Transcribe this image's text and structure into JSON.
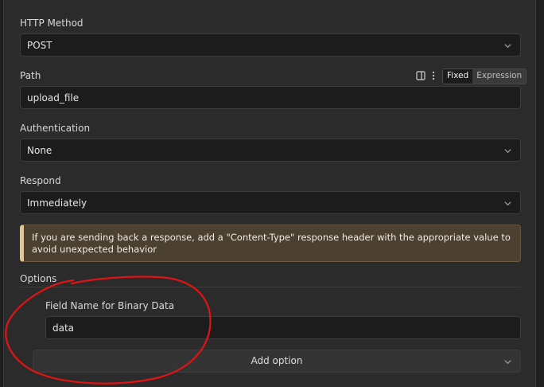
{
  "http_method": {
    "label": "HTTP Method",
    "value": "POST"
  },
  "path": {
    "label": "Path",
    "value": "upload_file",
    "mode_toggle": {
      "fixed_label": "Fixed",
      "expression_label": "Expression",
      "selected": "Fixed"
    }
  },
  "authentication": {
    "label": "Authentication",
    "value": "None"
  },
  "respond": {
    "label": "Respond",
    "value": "Immediately"
  },
  "notice": {
    "text": "If you are sending back a response, add a \"Content-Type\" response header with the appropriate value to avoid unexpected behavior"
  },
  "options": {
    "label": "Options",
    "binary_field": {
      "label": "Field Name for Binary Data",
      "value": "data"
    },
    "add_option_label": "Add option"
  },
  "colors": {
    "panel_bg": "#2b2b2b",
    "input_bg": "#1c1c1c",
    "notice_bg": "#4c4031",
    "notice_accent": "#e7c48f",
    "annotation_red": "#e01414"
  },
  "icons": {
    "select_chevron": "chevron-down-icon",
    "panel_toggle": "sidebar-panel-icon",
    "more_menu": "vertical-dots-icon"
  }
}
